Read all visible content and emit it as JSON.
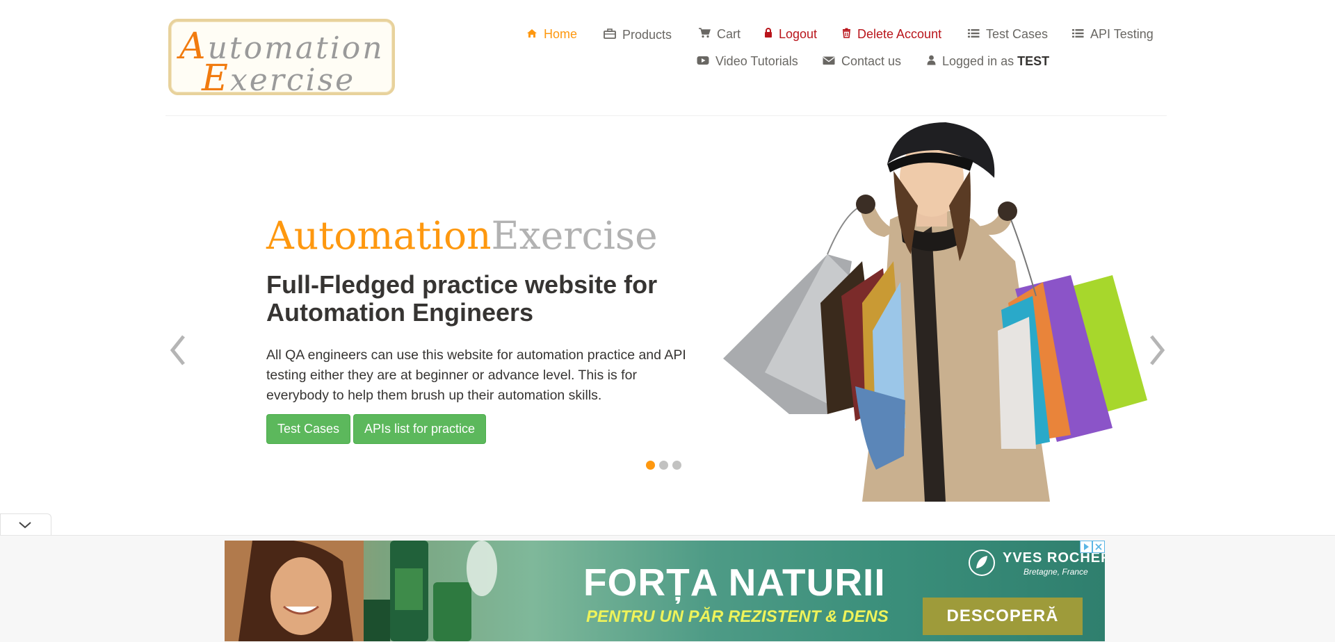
{
  "logo": {
    "line1_cap": "A",
    "line1_rest": "utomation",
    "line2_cap": "E",
    "line2_rest": "xercise"
  },
  "nav": {
    "home": "Home",
    "products": "Products",
    "cart": "Cart",
    "logout": "Logout",
    "delete_account": "Delete Account",
    "test_cases": "Test Cases",
    "api_testing": "API Testing",
    "video_tutorials": "Video Tutorials",
    "contact_us": "Contact us",
    "logged_in_prefix": "Logged in as",
    "logged_in_user": "TEST"
  },
  "slider": {
    "brand_part1": "Automation",
    "brand_part2": "Exercise",
    "headline": "Full-Fledged practice website for Automation Engineers",
    "description": "All QA engineers can use this website for automation practice and API testing either they are at beginner or advance level. This is for everybody to help them brush up their automation skills.",
    "btn_test_cases": "Test Cases",
    "btn_apis": "APIs list for practice",
    "active_slide": 1,
    "slide_count": 3
  },
  "ad": {
    "headline": "FORȚA NATURII",
    "subline": "PENTRU UN PĂR REZISTENT & DENS",
    "brand": "YVES ROCHER",
    "tagline": "Bretagne, France",
    "cta": "DESCOPERĂ"
  },
  "colors": {
    "accent": "#fe980f",
    "danger": "#b9151b",
    "success": "#5cb85c",
    "text": "#696763",
    "heading": "#363432"
  },
  "icons": [
    "home-icon",
    "briefcase-icon",
    "cart-icon",
    "lock-icon",
    "trash-icon",
    "list-icon",
    "youtube-icon",
    "envelope-icon",
    "user-icon",
    "chevron-left-icon",
    "chevron-right-icon",
    "chevron-down-icon"
  ]
}
